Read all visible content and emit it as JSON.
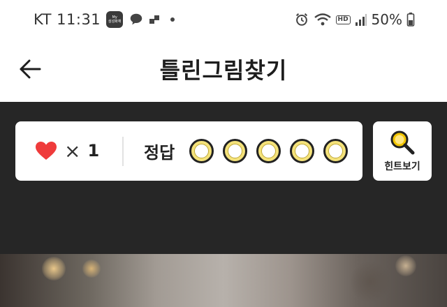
{
  "status_bar": {
    "carrier_time": "KT 11:31",
    "battery": "50%",
    "hd": "HD",
    "app_icon_text": [
      "My",
      "삼성화재"
    ]
  },
  "header": {
    "title": "틀린그림찾기"
  },
  "game": {
    "lives_symbol": "×",
    "lives_count": "1",
    "answer_label": "정답",
    "answers_found": 0,
    "answers_total": 5,
    "hint_label": "힌트보기"
  },
  "colors": {
    "heart": "#ef3b3b",
    "slot_fill": "#f4e27a",
    "dark_bg": "#262626",
    "hint_icon": "#f2c500"
  },
  "icons": [
    "back-arrow-icon",
    "heart-icon",
    "magnifier-icon",
    "alarm-icon",
    "wifi-icon",
    "signal-icon",
    "battery-icon",
    "talk-icon"
  ]
}
